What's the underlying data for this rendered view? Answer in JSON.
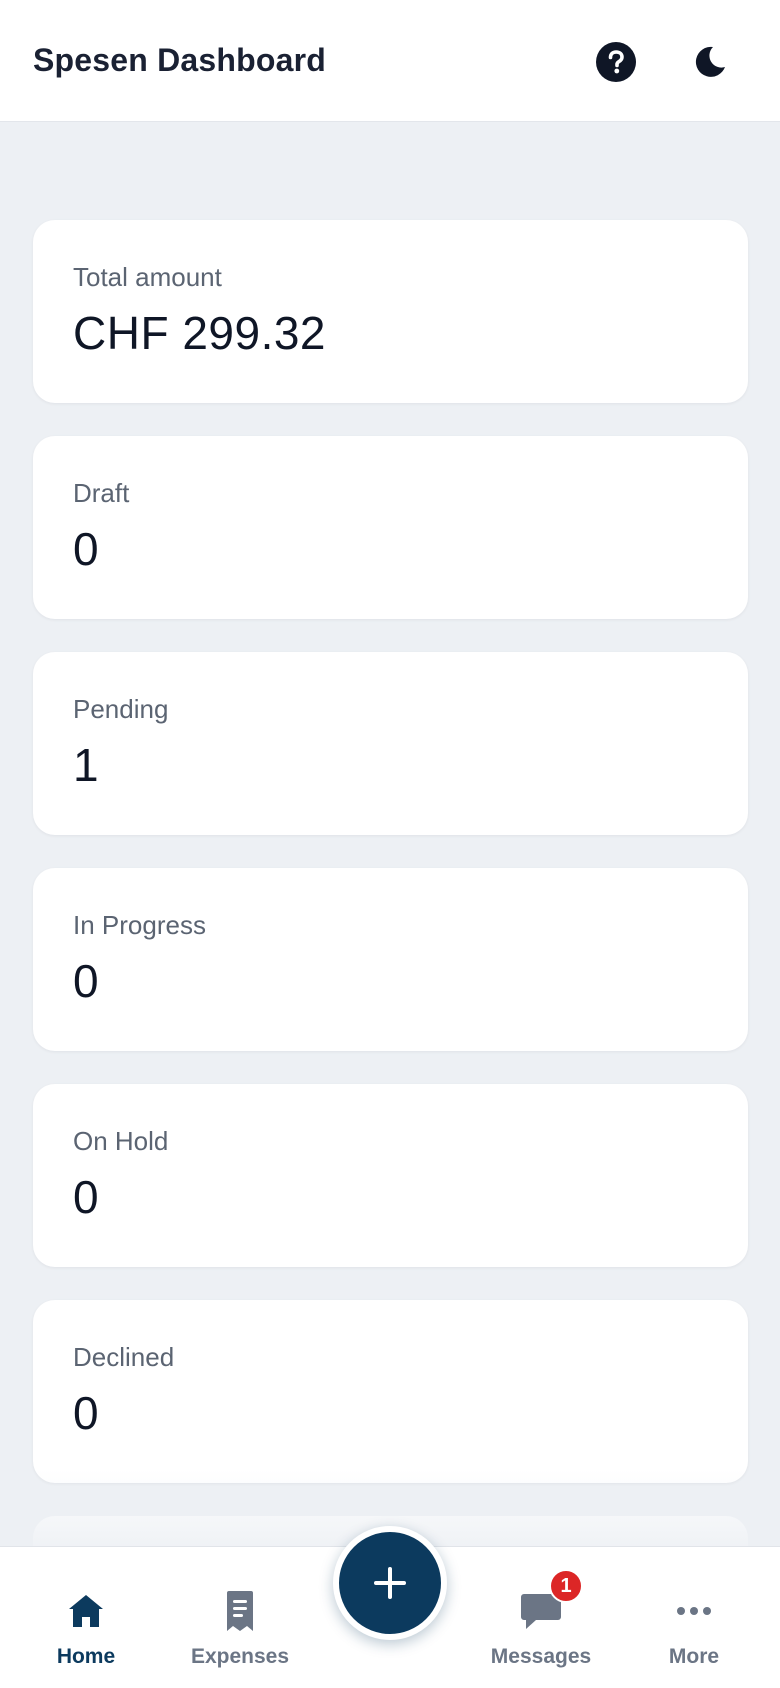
{
  "header": {
    "title": "Spesen Dashboard",
    "help_icon": "question-circle-icon",
    "theme_icon": "moon-icon"
  },
  "cards": [
    {
      "label": "Total amount",
      "value": "CHF 299.32"
    },
    {
      "label": "Draft",
      "value": "0"
    },
    {
      "label": "Pending",
      "value": "1"
    },
    {
      "label": "In Progress",
      "value": "0"
    },
    {
      "label": "On Hold",
      "value": "0"
    },
    {
      "label": "Declined",
      "value": "0"
    }
  ],
  "nav": {
    "home": {
      "label": "Home",
      "icon": "home-icon",
      "active": true
    },
    "expenses": {
      "label": "Expenses",
      "icon": "receipt-icon"
    },
    "messages": {
      "label": "Messages",
      "icon": "chat-bubble-icon",
      "badge": "1"
    },
    "more": {
      "label": "More",
      "icon": "ellipsis-icon"
    }
  },
  "fab": {
    "icon": "plus-icon"
  },
  "colors": {
    "primary": "#0c3a5e",
    "background": "#edf0f4",
    "badge": "#dc2626",
    "muted": "#6b7585"
  }
}
